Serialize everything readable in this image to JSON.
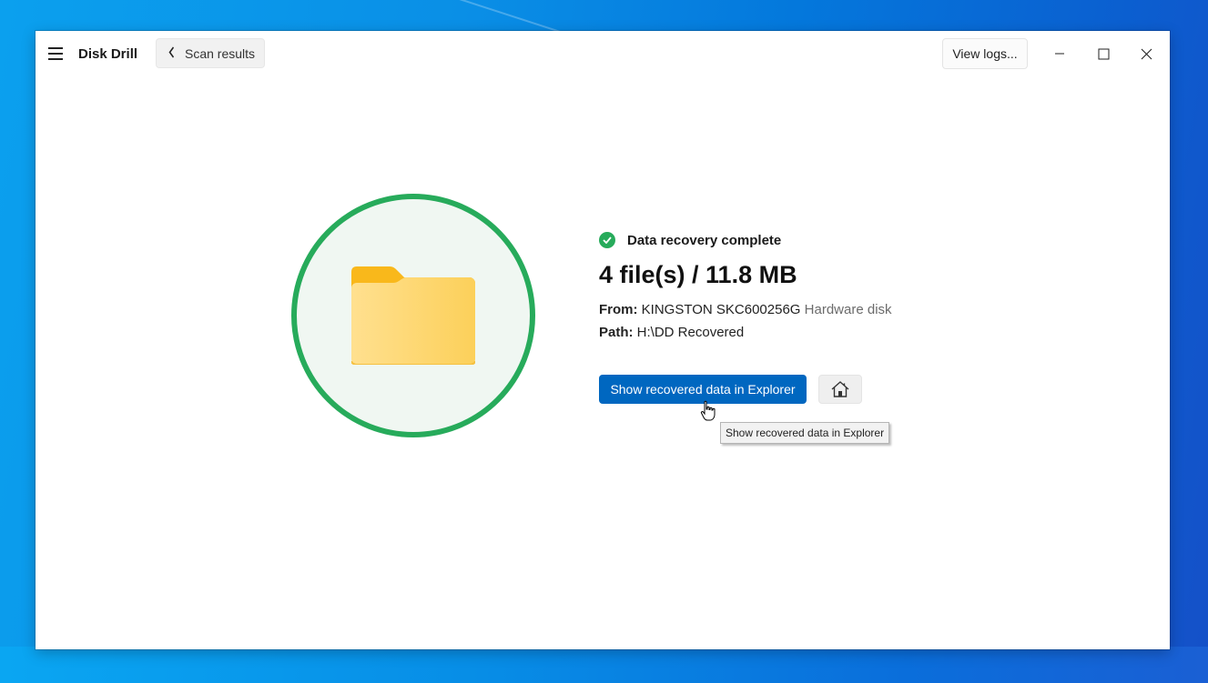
{
  "app": {
    "title": "Disk Drill",
    "back_label": "Scan results",
    "view_logs_label": "View logs..."
  },
  "window_controls": {
    "minimize": "minimize-icon",
    "maximize": "maximize-icon",
    "close": "close-icon"
  },
  "result": {
    "status": "Data recovery complete",
    "summary": "4 file(s) / 11.8 MB",
    "from_label": "From:",
    "from_value": "KINGSTON SKC600256G",
    "from_type": "Hardware disk",
    "path_label": "Path:",
    "path_value": "H:\\DD Recovered"
  },
  "actions": {
    "primary_label": "Show recovered data in Explorer",
    "home_icon": "home-icon",
    "tooltip": "Show recovered data in Explorer"
  },
  "colors": {
    "accent": "#0067c0",
    "success": "#27ab5b",
    "folder": "#fcd466"
  }
}
